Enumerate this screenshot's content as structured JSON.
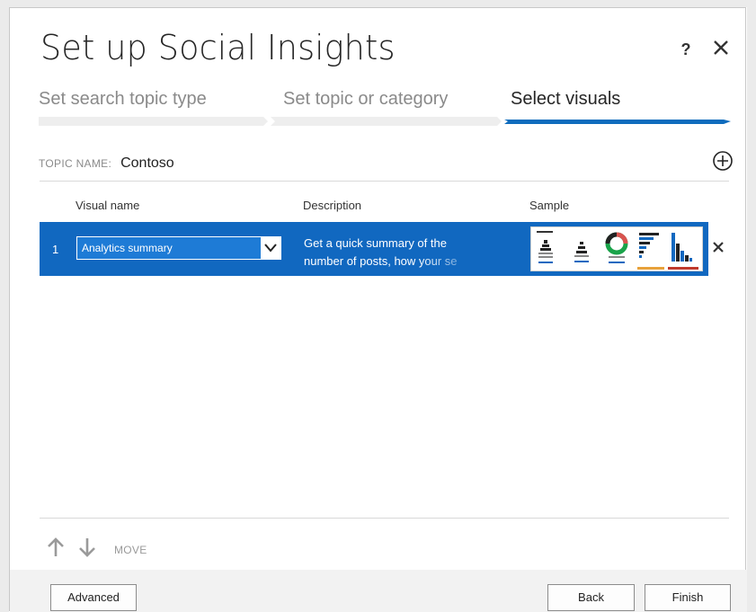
{
  "dialog": {
    "title": "Set up Social Insights",
    "help_label": "?"
  },
  "steps": [
    {
      "label": "Set search topic type",
      "active": false
    },
    {
      "label": "Set topic or category",
      "active": false
    },
    {
      "label": "Select visuals",
      "active": true
    }
  ],
  "topic": {
    "label": "TOPIC NAME:",
    "value": "Contoso"
  },
  "table": {
    "headers": [
      "Visual name",
      "Description",
      "Sample"
    ],
    "rows": [
      {
        "index": "1",
        "visual_name": "Analytics summary",
        "description": "Get a quick summary of the number of posts, how your se"
      }
    ]
  },
  "move": {
    "label": "MOVE"
  },
  "footer": {
    "advanced_label": "Advanced",
    "back_label": "Back",
    "finish_label": "Finish"
  },
  "colors": {
    "accent": "#1168c0",
    "step_active": "#0f6cbd",
    "step_inactive": "#eeeeee"
  }
}
